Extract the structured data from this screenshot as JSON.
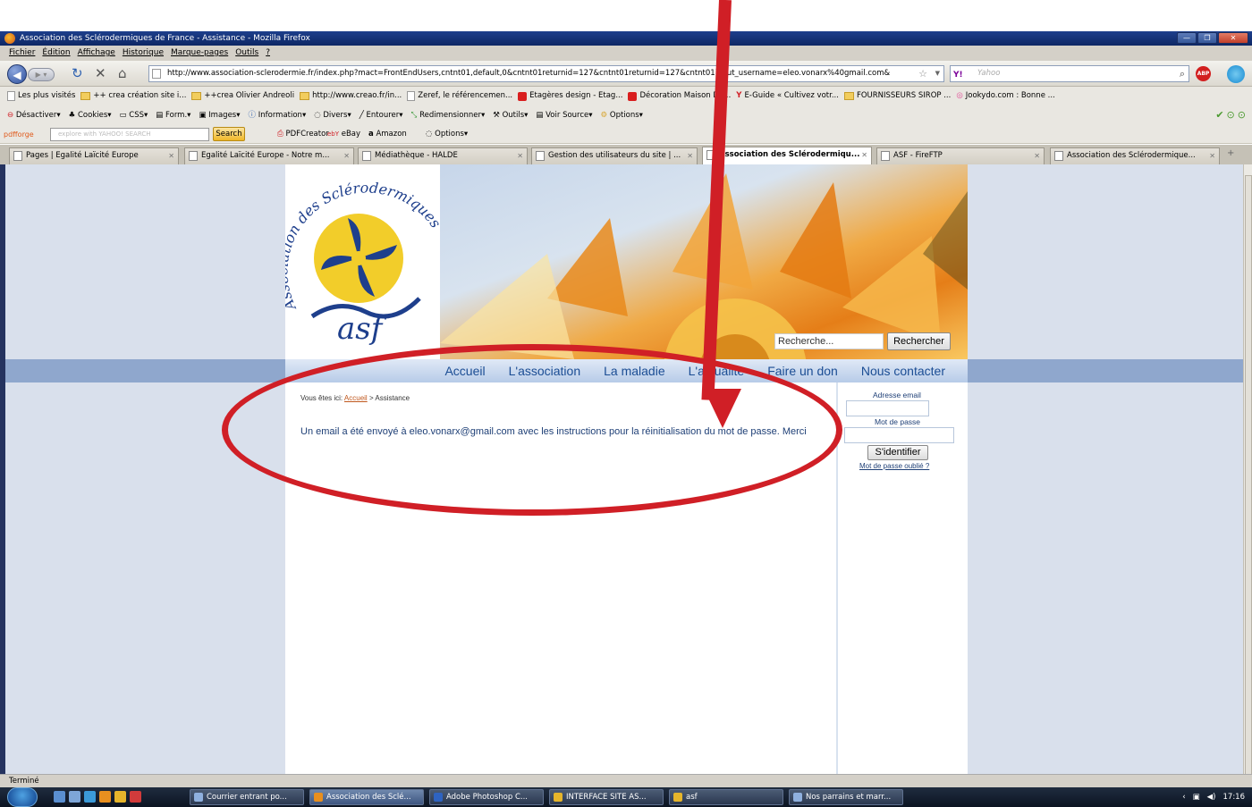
{
  "window": {
    "title": "Association des Sclérodermiques de France - Assistance - Mozilla Firefox"
  },
  "menu": {
    "items": [
      "Fichier",
      "Édition",
      "Affichage",
      "Historique",
      "Marque-pages",
      "Outils",
      "?"
    ]
  },
  "navigation": {
    "url": "http://www.association-sclerodermie.fr/index.php?mact=FrontEndUsers,cntnt01,default,0&cntnt01returnid=127&cntnt01returnid=127&cntnt01input_username=eleo.vonarx%40gmail.com&",
    "search_placeholder": "Yahoo",
    "search_engine_label": "Y!"
  },
  "bookmarks": [
    "Les plus visités",
    "++ crea création site i...",
    "++crea Olivier Andreoli",
    "http://www.creao.fr/in...",
    "Zeref, le référencemen...",
    "Etagères design - Etag...",
    "Décoration Maison De...",
    "E-Guide « Cultivez votr...",
    "FOURNISSEURS SIROP ...",
    "Jookydo.com : Bonne ..."
  ],
  "devbar": {
    "items": [
      "Désactiver",
      "Cookies",
      "CSS",
      "Form.",
      "Images",
      "Information",
      "Divers",
      "Entourer",
      "Redimensionner",
      "Outils",
      "Voir Source",
      "Options"
    ]
  },
  "yahoobar": {
    "pdfforge": "pdfforge",
    "search_placeholder": "explore with YAHOO! SEARCH",
    "search_button": "Search",
    "pdfcreator": "PDFCreator",
    "ebay": "eBay",
    "amazon": "Amazon",
    "options": "Options"
  },
  "tabs": [
    {
      "label": "Pages | Egalité Laïcité Europe"
    },
    {
      "label": "Egalité Laïcité Europe - Notre m..."
    },
    {
      "label": "Médiathèque - HALDE"
    },
    {
      "label": "Gestion des utilisateurs du site | ..."
    },
    {
      "label": "Association des Sclérodermiqu..."
    },
    {
      "label": "ASF - FireFTP"
    },
    {
      "label": "Association des Sclérodermique..."
    }
  ],
  "site": {
    "logo_text": "Association des Sclérodermiques de France",
    "logo_monogram": "asf",
    "search_placeholder": "Recherche...",
    "search_button": "Rechercher",
    "nav": [
      "Accueil",
      "L'association",
      "La maladie",
      "L'actualite",
      "Faire un don",
      "Nous contacter"
    ],
    "breadcrumb_prefix": "Vous êtes ici:",
    "breadcrumb_home": "Accueil",
    "breadcrumb_current": "> Assistance",
    "message": "Un email a été envoyé à eleo.vonarx@gmail.com avec les instructions pour la réinitialisation du mot de passe. Merci",
    "login": {
      "email_label": "Adresse email",
      "password_label": "Mot de passe",
      "submit": "S'identifier",
      "forgot": "Mot de passe oublié ?"
    }
  },
  "status": {
    "text": "Terminé"
  },
  "taskbar": {
    "tasks": [
      "Courrier entrant po...",
      "Association des Sclé...",
      "Adobe Photoshop C...",
      "INTERFACE SITE AS...",
      "asf",
      "Nos parrains et marr..."
    ],
    "clock": "17:16"
  },
  "colors": {
    "annotation_red": "#d01f26",
    "nav_link": "#1b4d94",
    "nav_strip": "#8fa7cd"
  }
}
